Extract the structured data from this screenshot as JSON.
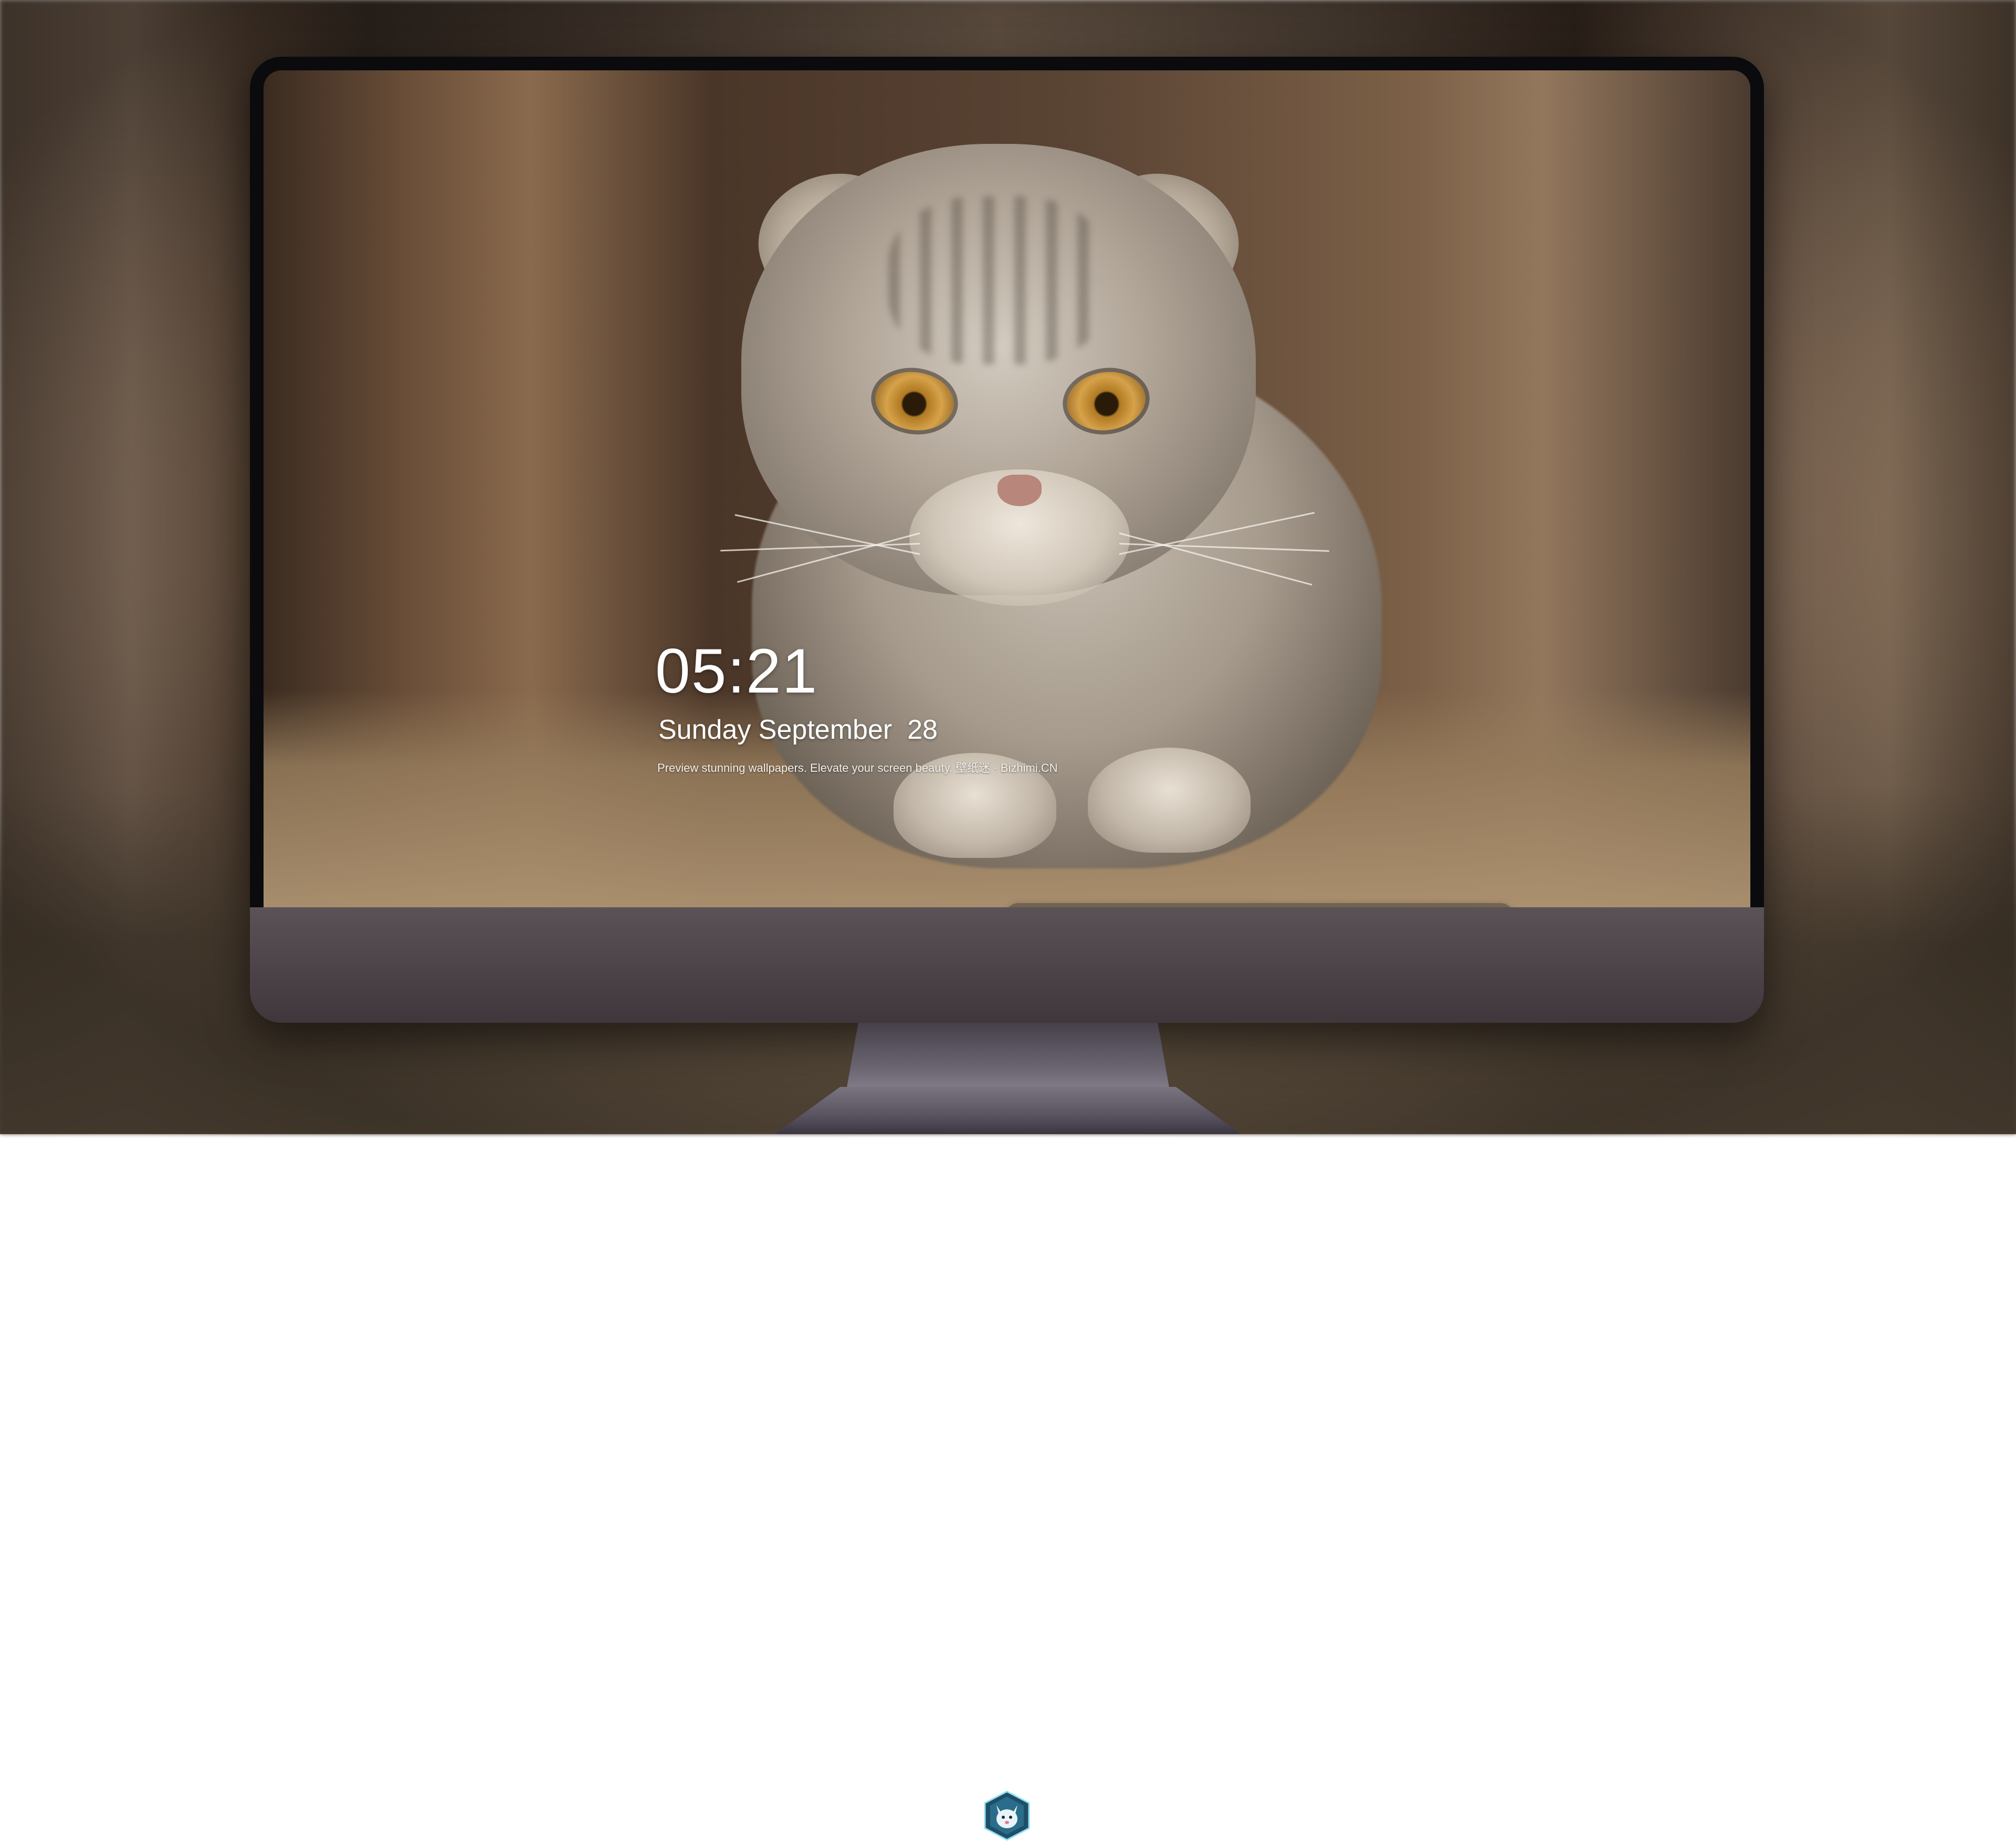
{
  "lock_screen": {
    "time": "05:21",
    "date": "Sunday September  28",
    "tagline": "Preview stunning wallpapers. Elevate your screen beauty. 壁纸迷 · Bizhimi.CN"
  },
  "dock": {
    "apps": [
      {
        "name": "messages-icon",
        "color": "#34c759"
      },
      {
        "name": "weather-icon",
        "color": "#2f8cf0"
      },
      {
        "name": "clock-icon",
        "color": "#1a1a1a"
      },
      {
        "name": "preview-icon",
        "color": "#f4d24a"
      },
      {
        "name": "video-clapper-icon",
        "color": "#5fc8e8"
      },
      {
        "name": "notes-icon",
        "color": "#fbd64a"
      },
      {
        "name": "photos-collage-icon",
        "color": "#e8e4d8"
      },
      {
        "name": "music-icon",
        "color": "#e34fd6"
      },
      {
        "name": "app-store-icon",
        "color": "#2a7ff0"
      },
      {
        "name": "camera-icon",
        "color": "#8a8a8e"
      }
    ]
  },
  "device": {
    "logo": "wolf-mascot-logo"
  }
}
